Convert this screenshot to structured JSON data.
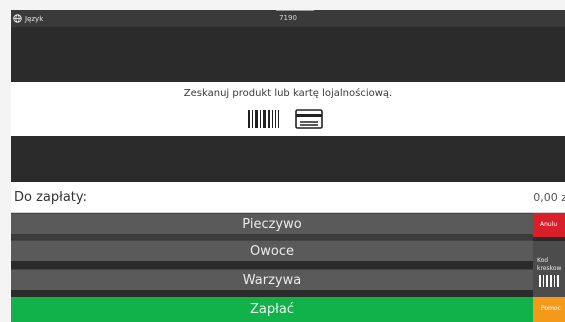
{
  "topbar": {
    "language_label": "Język",
    "terminal_number": "7190"
  },
  "scan": {
    "prompt": "Zeskanuj produkt lub kartę lojalnościową.",
    "icons": [
      "barcode-icon",
      "loyalty-card-icon"
    ]
  },
  "total": {
    "label": "Do zapłaty:",
    "amount": "0,00 z"
  },
  "categories": [
    {
      "label": "Pieczywo"
    },
    {
      "label": "Owoce"
    },
    {
      "label": "Warzywa"
    }
  ],
  "pay_button": {
    "label": "Zapłać"
  },
  "side": {
    "cancel_label": "Anulu",
    "barcode_label_line1": "Kod",
    "barcode_label_line2": "kreskow",
    "help_label": "Pomoc"
  },
  "colors": {
    "pay": "#12b24b",
    "cancel": "#d9202a",
    "help": "#f39a1a",
    "category": "#5a5a5a"
  }
}
